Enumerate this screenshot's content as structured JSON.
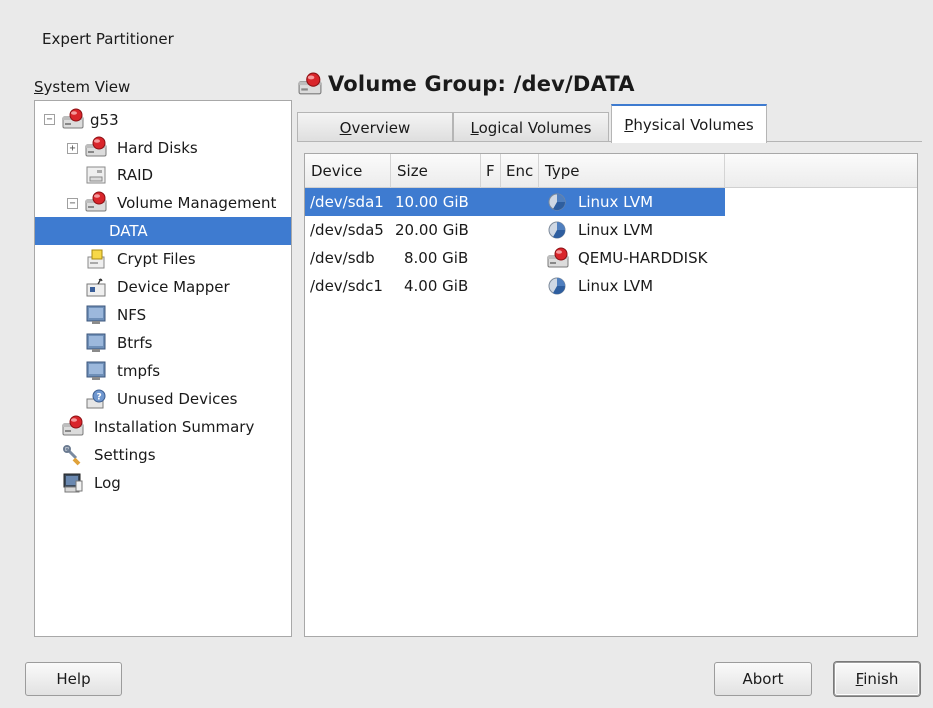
{
  "window": {
    "title": "Expert Partitioner"
  },
  "system_view": {
    "label": "System View",
    "tree": [
      {
        "label": "g53",
        "icon": "harddisk-icon",
        "expander": "minus"
      },
      {
        "label": "Hard Disks",
        "icon": "harddisk-icon",
        "expander": "plus"
      },
      {
        "label": "RAID",
        "icon": "raid-icon"
      },
      {
        "label": "Volume Management",
        "icon": "harddisk-icon",
        "expander": "minus"
      },
      {
        "label": "DATA",
        "selected": true
      },
      {
        "label": "Crypt Files",
        "icon": "crypt-files-icon"
      },
      {
        "label": "Device Mapper",
        "icon": "device-mapper-icon"
      },
      {
        "label": "NFS",
        "icon": "nfs-icon"
      },
      {
        "label": "Btrfs",
        "icon": "btrfs-icon"
      },
      {
        "label": "tmpfs",
        "icon": "tmpfs-icon"
      },
      {
        "label": "Unused Devices",
        "icon": "unused-devices-icon"
      },
      {
        "label": "Installation Summary",
        "icon": "harddisk-icon"
      },
      {
        "label": "Settings",
        "icon": "settings-wrench-icon"
      },
      {
        "label": "Log",
        "icon": "log-icon"
      }
    ]
  },
  "volume_group": {
    "title": "Volume Group: /dev/DATA",
    "icon": "harddisk-icon",
    "tabs": [
      {
        "label": "Overview"
      },
      {
        "label": "Logical Volumes"
      },
      {
        "label": "Physical Volumes",
        "active": true
      }
    ]
  },
  "table": {
    "columns": [
      "Device",
      "Size",
      "F",
      "Enc",
      "Type"
    ],
    "rows": [
      {
        "device": "/dev/sda1",
        "size": "10.00 GiB",
        "f": "",
        "enc": "",
        "type": "Linux LVM",
        "icon": "lvm-pie-icon",
        "selected": true
      },
      {
        "device": "/dev/sda5",
        "size": "20.00 GiB",
        "f": "",
        "enc": "",
        "type": "Linux LVM",
        "icon": "lvm-pie-icon"
      },
      {
        "device": "/dev/sdb",
        "size": "8.00 GiB",
        "f": "",
        "enc": "",
        "type": "QEMU-HARDDISK",
        "icon": "harddisk-icon"
      },
      {
        "device": "/dev/sdc1",
        "size": "4.00 GiB",
        "f": "",
        "enc": "",
        "type": "Linux LVM",
        "icon": "lvm-pie-icon"
      }
    ]
  },
  "buttons": {
    "help": "Help",
    "abort": "Abort",
    "finish": "Finish"
  },
  "colors": {
    "selection": "#3e7bd0",
    "background": "#eaeaea",
    "disk_red": "#d9252b"
  }
}
